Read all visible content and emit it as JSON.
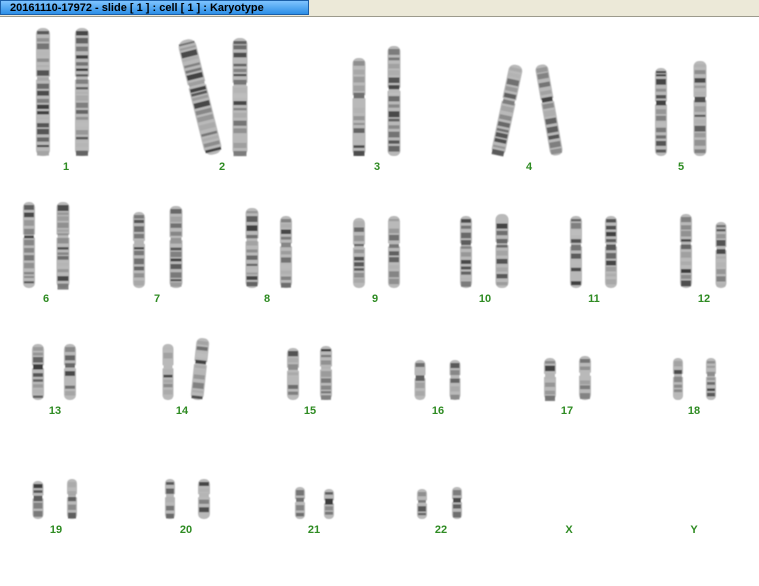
{
  "window": {
    "title": "20161110-17972 - slide [ 1 ] : cell [ 1 ] : Karyotype"
  },
  "karyotype": {
    "label_color": "#2e8b22",
    "slots": [
      {
        "label": "1"
      },
      {
        "label": "2"
      },
      {
        "label": "3"
      },
      {
        "label": "4"
      },
      {
        "label": "5"
      },
      {
        "label": "6"
      },
      {
        "label": "7"
      },
      {
        "label": "8"
      },
      {
        "label": "9"
      },
      {
        "label": "10"
      },
      {
        "label": "11"
      },
      {
        "label": "12"
      },
      {
        "label": "13"
      },
      {
        "label": "14"
      },
      {
        "label": "15"
      },
      {
        "label": "16"
      },
      {
        "label": "17"
      },
      {
        "label": "18"
      },
      {
        "label": "19"
      },
      {
        "label": "20"
      },
      {
        "label": "21"
      },
      {
        "label": "22"
      },
      {
        "label": "X"
      },
      {
        "label": "Y"
      }
    ]
  }
}
